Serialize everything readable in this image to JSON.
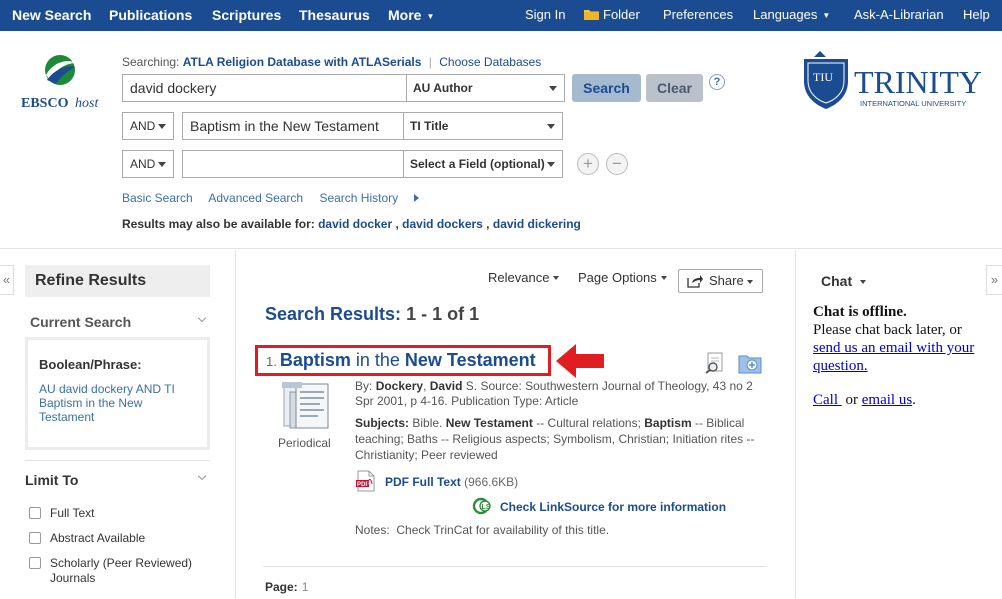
{
  "topnav": {
    "left": [
      "New Search",
      "Publications",
      "Scriptures",
      "Thesaurus",
      "More"
    ],
    "right": [
      "Sign In",
      "Folder",
      "Preferences",
      "Languages",
      "Ask-A-Librarian",
      "Help"
    ]
  },
  "colors": {
    "nav_bg": "#1b4b91",
    "link": "#1b4b91",
    "highlight": "#e01e22"
  },
  "header": {
    "logo_text": "EBSCOhost",
    "searching_label": "Searching:",
    "database": "ATLA Religion Database with ATLASerials",
    "choose_databases": "Choose Databases",
    "rows": [
      {
        "bool": "",
        "term": "david dockery",
        "field": "AU Author"
      },
      {
        "bool": "AND",
        "term": "Baptism in the New Testament",
        "field": "TI Title"
      },
      {
        "bool": "AND",
        "term": "",
        "field": "Select a Field (optional)"
      }
    ],
    "search_button": "Search",
    "clear_button": "Clear",
    "help": "?",
    "links": [
      "Basic Search",
      "Advanced Search",
      "Search History"
    ],
    "also_label": "Results may also be available for:",
    "suggestions": [
      "david docker",
      "david dockers",
      "david dickering"
    ],
    "institution": {
      "name": "TRINITY",
      "sub": "INTERNATIONAL UNIVERSITY",
      "shield": "TIU"
    }
  },
  "refine": {
    "title": "Refine Results",
    "current_search": "Current Search",
    "boolean_label": "Boolean/Phrase:",
    "query": "AU david dockery AND TI Baptism in the New Testament",
    "limit_to": "Limit To",
    "limits": [
      "Full Text",
      "Abstract Available",
      "Scholarly (Peer Reviewed) Journals"
    ]
  },
  "results": {
    "sort": "Relevance",
    "page_options": "Page Options",
    "share": "Share",
    "heading": "Search Results:",
    "range": "1 - 1 of 1",
    "item": {
      "num": "1.",
      "title_parts": [
        "Baptism",
        " in the ",
        "New Testament"
      ],
      "by_label": "By:",
      "author_b": "Dockery",
      "author_bold2": "David",
      "author_rest": "S. Source: Southwestern Journal of Theology, 43 no 2 Spr 2001, p 4-16. Publication Type: Article",
      "author_sep": ", ",
      "subjects_label": "Subjects:",
      "subjects_p1": "Bible.",
      "subjects_b1": "New Testament",
      "subjects_p2": "-- Cultural relations;",
      "subjects_b2": "Baptism",
      "subjects_p3": "-- Biblical teaching; Baths -- Religious aspects; Symbolism, Christian; Initiation rites -- Christianity; Peer reviewed",
      "type": "Periodical",
      "pdf": "PDF Full Text",
      "pdf_size": "(966.6KB)",
      "linksource": "Check LinkSource for more information",
      "notes": "Notes:  Check TrinCat for availability of this title."
    },
    "page_label": "Page:",
    "page_num": "1"
  },
  "chat": {
    "title": "Chat",
    "offline": "Chat is offline.",
    "line1": "Please chat back later, or",
    "email_link": "send us an email with your question.",
    "call": "Call ",
    "or": "or",
    "email": "email us",
    "period": "."
  }
}
